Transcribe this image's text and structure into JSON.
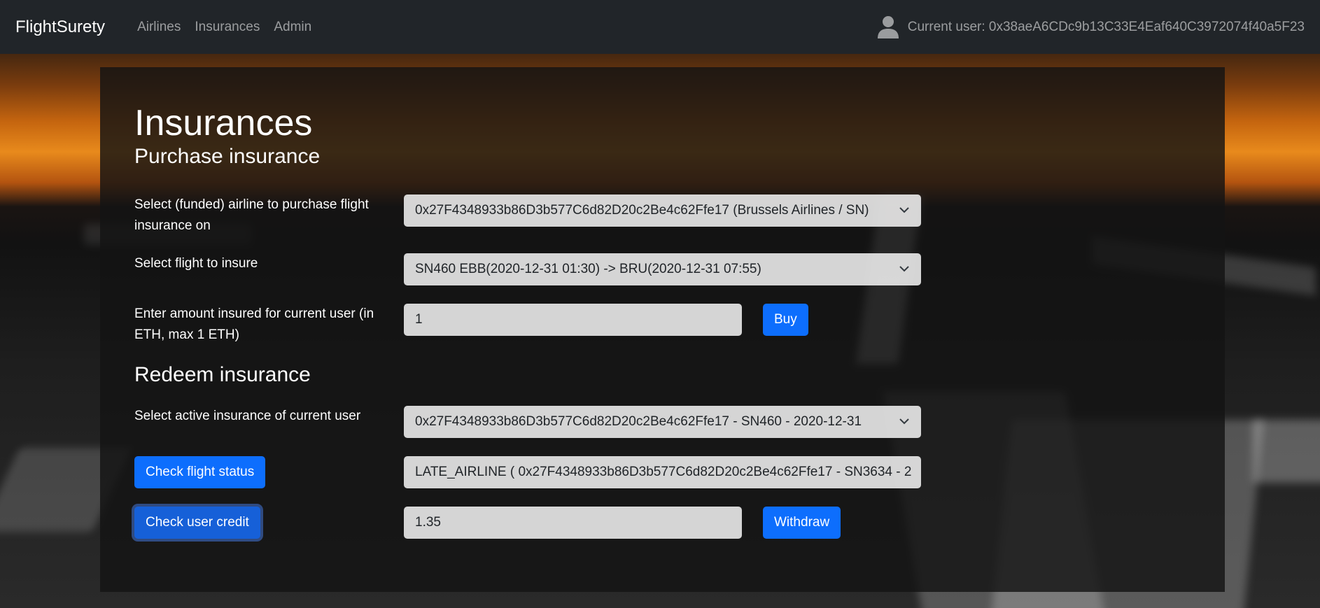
{
  "navbar": {
    "brand": "FlightSurety",
    "links": [
      "Airlines",
      "Insurances",
      "Admin"
    ],
    "current_user": "Current user: 0x38aeA6CDc9b13C33E4Eaf640C3972074f40a5F23"
  },
  "page": {
    "title": "Insurances",
    "purchase": {
      "heading": "Purchase insurance",
      "airline_label": "Select (funded) airline to purchase flight insurance on",
      "airline_value": "0x27F4348933b86D3b577C6d82D20c2Be4c62Ffe17 (Brussels Airlines / SN)",
      "flight_label": "Select flight to insure",
      "flight_value": "SN460 EBB(2020-12-31 01:30) -> BRU(2020-12-31 07:55)",
      "amount_label": "Enter amount insured for current user (in ETH, max 1 ETH)",
      "amount_value": "1",
      "buy_button": "Buy"
    },
    "redeem": {
      "heading": "Redeem insurance",
      "insurance_label": "Select active insurance of current user",
      "insurance_value": "0x27F4348933b86D3b577C6d82D20c2Be4c62Ffe17 - SN460 - 2020-12-31",
      "check_status_button": "Check flight status",
      "status_value": "LATE_AIRLINE  ( 0x27F4348933b86D3b577C6d82D20c2Be4c62Ffe17 - SN3634 - 2",
      "check_credit_button": "Check user credit",
      "credit_value": "1.35",
      "withdraw_button": "Withdraw"
    }
  },
  "colors": {
    "navbar_bg": "#212529",
    "primary": "#0d6efd"
  }
}
